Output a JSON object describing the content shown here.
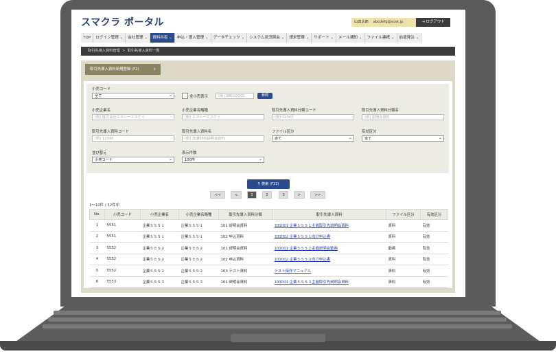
{
  "header": {
    "logo": "スマクラ ポータル",
    "user_name": "山田太郎",
    "user_email": "abcdefg@scsk.jp",
    "logout_label": "ログアウト"
  },
  "nav": {
    "items": [
      "TOP",
      "ログイン管理",
      "会社管理",
      "資料共有",
      "申込・導入管理",
      "データチェック",
      "システム状況照会",
      "請求管理",
      "サポート",
      "メール通知",
      "ファイル連携",
      "前遣発注"
    ]
  },
  "breadcrumb": {
    "parent": "取引先導入資料管理",
    "separator": ">",
    "current": "取引先導入資料一覧"
  },
  "register_button": "取引先導入資料新規登録 (F2)",
  "filters": {
    "retailer_code": {
      "label": "小売コード",
      "value": "全て"
    },
    "all_retailers_label": "全小売表示",
    "retailer_search_placeholder": "(例) SMCL0001",
    "reference_label": "参照",
    "retailer_name": {
      "label": "小売企業名",
      "placeholder": "(例) 株式会社エスシーエスケイ"
    },
    "retailer_short": {
      "label": "小売企業名略種",
      "placeholder": "(例) エスシーエスケイ"
    },
    "doc_class_code": {
      "label": "取引先導入資料分類コード",
      "placeholder": "(例) 12345"
    },
    "doc_class_name": {
      "label": "取引先導入資料分類名",
      "placeholder": "(例) 説明会資料"
    },
    "doc_code": {
      "label": "取引先導入資料コード",
      "placeholder": "(例) 12345"
    },
    "doc_name": {
      "label": "取引先導入資料名",
      "placeholder": "(例) 流通BMS説明会資料"
    },
    "file_type": {
      "label": "ファイル区分",
      "value": "全て"
    },
    "valid_type": {
      "label": "有効区分",
      "value": "全て"
    },
    "sort": {
      "label": "並び替え",
      "value": "小売コード"
    },
    "page_size": {
      "label": "表示件数",
      "value": "100件"
    },
    "search_label": "検索 (F12)"
  },
  "pager": {
    "first": "<<",
    "prev": "<",
    "pages": [
      "1",
      "2",
      "3"
    ],
    "current": "1",
    "next": ">",
    "last": ">>"
  },
  "result_count": "1〜10件 / 52件中",
  "table": {
    "headers": [
      "No.",
      "小売コード",
      "小売企業名",
      "小売企業名略種",
      "取引先導入資料分類",
      "取引先導入資料",
      "ファイル区分",
      "有効区分"
    ],
    "rows": [
      [
        "1",
        "5551",
        "企業５５５１",
        "企業５５５１",
        "101 説明会資料",
        "101001 企業５５５１主催取引先説明会資料",
        "資料",
        "有効"
      ],
      [
        "2",
        "5551",
        "企業５５５１",
        "企業５５５１",
        "102 申込資料",
        "101002 企業５５５１向け申込書",
        "資料",
        "有効"
      ],
      [
        "3",
        "5552",
        "企業５５５２",
        "企業５５５２",
        "101 説明会資料",
        "101001 企業５５５２主催説明会動画",
        "動画",
        "有効"
      ],
      [
        "4",
        "5552",
        "企業５５５２",
        "企業５５５２",
        "102 申込資料",
        "101002 企業５５５２向け申込書",
        "資料",
        "有効"
      ],
      [
        "5",
        "5552",
        "企業５５５２",
        "企業５５５２",
        "103 テスト資料",
        "テスト操作マニュアル",
        "資料",
        "有効"
      ],
      [
        "6",
        "5553",
        "企業５５５３",
        "企業５５５３",
        "101 説明会資料",
        "103001 企業５５５３主催取引先説明会資料",
        "資料",
        "有効"
      ]
    ]
  },
  "colors": {
    "brand": "#2b3e7a",
    "nav_active": "#2b4a8b",
    "panel": "#ddd9c8",
    "register": "#8b8462"
  }
}
